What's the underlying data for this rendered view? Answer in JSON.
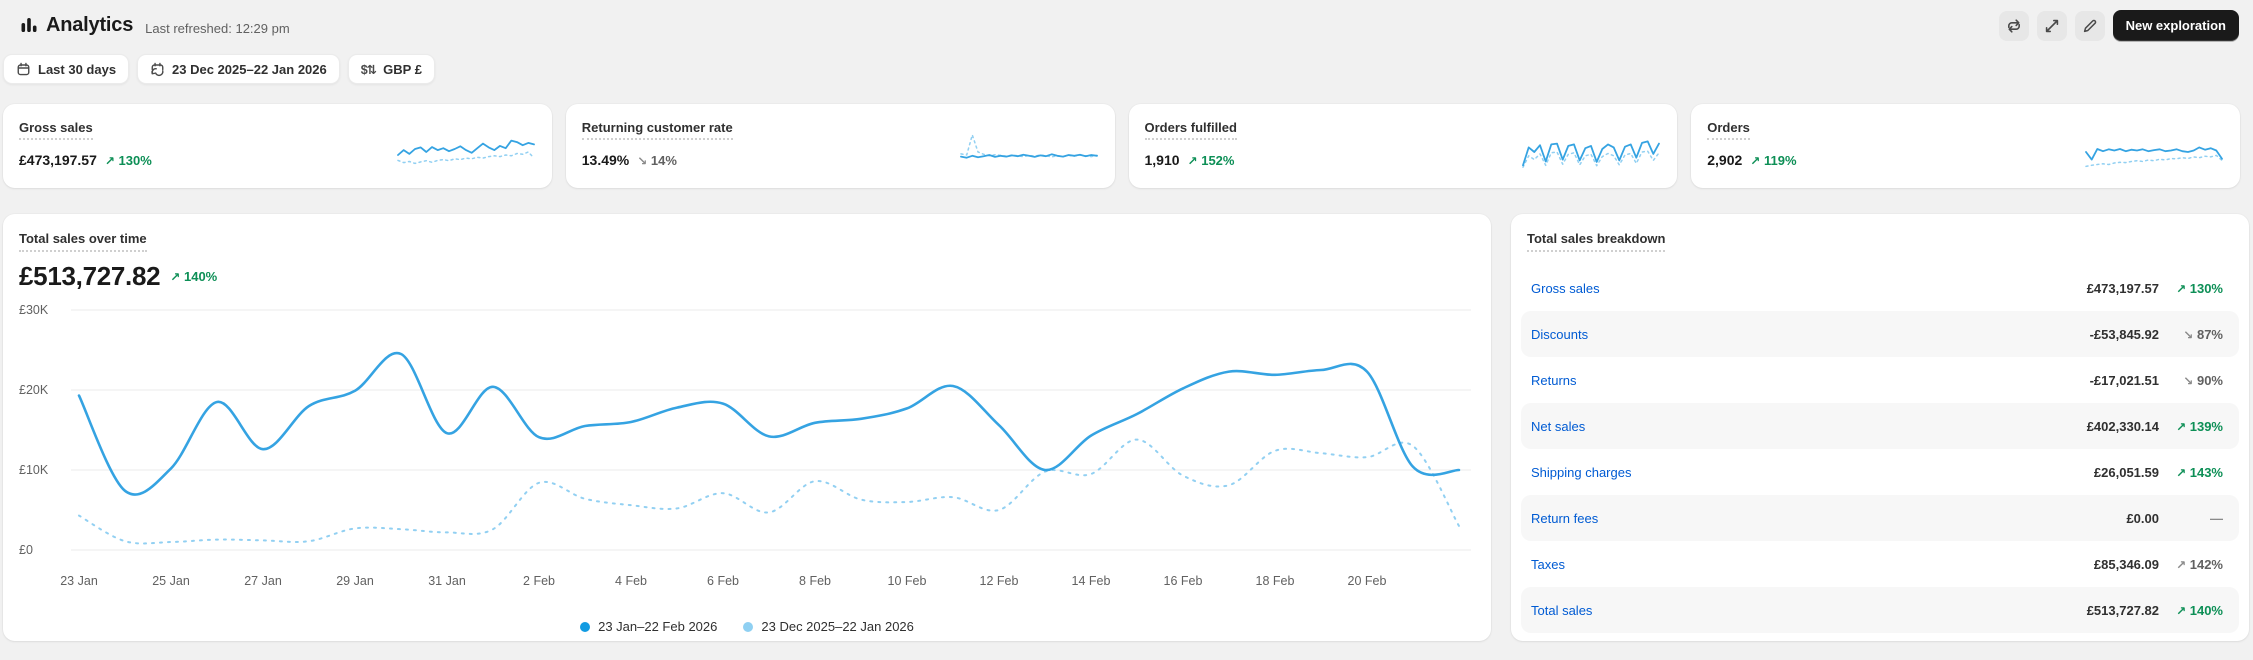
{
  "header": {
    "title": "Analytics",
    "last_refreshed": "Last refreshed: 12:29 pm",
    "new_exploration_label": "New exploration",
    "icon_actions": [
      "cycle-icon",
      "expand-icon",
      "edit-icon"
    ]
  },
  "filters": {
    "date_range": "Last 30 days",
    "compare_range": "23 Dec 2025–22 Jan 2026",
    "currency": "GBP £"
  },
  "colors": {
    "line_current": "#35a3e2",
    "line_previous": "#92d0f2",
    "legend_dot_current": "#119be2",
    "legend_dot_previous": "#8fd0f2",
    "success_green": "#0d8f56",
    "link_blue": "#005bd3",
    "grid": "#ebebeb"
  },
  "metric_cards": [
    {
      "label": "Gross sales",
      "value": "£473,197.57",
      "change": "130%",
      "direction": "up",
      "positive": true,
      "spark_current": [
        0.42,
        0.55,
        0.45,
        0.58,
        0.62,
        0.5,
        0.63,
        0.55,
        0.6,
        0.52,
        0.58,
        0.65,
        0.55,
        0.48,
        0.6,
        0.72,
        0.62,
        0.55,
        0.66,
        0.6,
        0.8,
        0.76,
        0.68,
        0.74,
        0.7
      ],
      "spark_previous": [
        0.28,
        0.22,
        0.25,
        0.2,
        0.24,
        0.27,
        0.23,
        0.28,
        0.3,
        0.27,
        0.32,
        0.3,
        0.34,
        0.32,
        0.36,
        0.34,
        0.38,
        0.4,
        0.38,
        0.42,
        0.4,
        0.46,
        0.44,
        0.5,
        0.34
      ]
    },
    {
      "label": "Returning customer rate",
      "value": "13.49%",
      "change": "14%",
      "direction": "down",
      "positive": false,
      "spark_current": [
        0.38,
        0.35,
        0.4,
        0.36,
        0.39,
        0.42,
        0.37,
        0.4,
        0.38,
        0.41,
        0.39,
        0.43,
        0.4,
        0.37,
        0.41,
        0.39,
        0.44,
        0.4,
        0.38,
        0.42,
        0.4,
        0.43,
        0.39,
        0.42,
        0.4
      ],
      "spark_previous": [
        0.45,
        0.42,
        0.95,
        0.5,
        0.44,
        0.4,
        0.43,
        0.41,
        0.39,
        0.42,
        0.4,
        0.38,
        0.41,
        0.39,
        0.42,
        0.4,
        0.37,
        0.4,
        0.38,
        0.41,
        0.39,
        0.42,
        0.4,
        0.38,
        0.41
      ]
    },
    {
      "label": "Orders fulfilled",
      "value": "1,910",
      "change": "152%",
      "direction": "up",
      "positive": true,
      "spark_current": [
        0.15,
        0.62,
        0.5,
        0.68,
        0.25,
        0.7,
        0.72,
        0.3,
        0.66,
        0.7,
        0.28,
        0.6,
        0.66,
        0.24,
        0.58,
        0.7,
        0.62,
        0.28,
        0.64,
        0.7,
        0.35,
        0.74,
        0.78,
        0.45,
        0.72
      ],
      "spark_previous": [
        0.1,
        0.4,
        0.3,
        0.45,
        0.15,
        0.48,
        0.5,
        0.18,
        0.44,
        0.48,
        0.16,
        0.4,
        0.44,
        0.14,
        0.38,
        0.46,
        0.4,
        0.16,
        0.42,
        0.46,
        0.2,
        0.5,
        0.52,
        0.28,
        0.48
      ]
    },
    {
      "label": "Orders",
      "value": "2,902",
      "change": "119%",
      "direction": "up",
      "positive": true,
      "spark_current": [
        0.5,
        0.3,
        0.58,
        0.52,
        0.57,
        0.54,
        0.58,
        0.52,
        0.56,
        0.54,
        0.57,
        0.52,
        0.55,
        0.57,
        0.52,
        0.54,
        0.57,
        0.52,
        0.5,
        0.54,
        0.62,
        0.56,
        0.6,
        0.54,
        0.32
      ],
      "spark_previous": [
        0.12,
        0.15,
        0.17,
        0.19,
        0.17,
        0.21,
        0.23,
        0.22,
        0.25,
        0.27,
        0.25,
        0.29,
        0.27,
        0.31,
        0.29,
        0.33,
        0.32,
        0.35,
        0.33,
        0.37,
        0.35,
        0.39,
        0.37,
        0.41,
        0.28
      ]
    }
  ],
  "chart_card": {
    "title": "Total sales over time",
    "value": "£513,727.82",
    "change": "140%",
    "direction": "up",
    "positive": true
  },
  "chart_data": {
    "type": "line",
    "title": "Total sales over time",
    "unit": "GBP thousands",
    "x_start": "23 Jan 2026",
    "x_end": "22 Feb 2026",
    "interval": "daily",
    "ylim": [
      0,
      30000
    ],
    "y_ticks": [
      "£30K",
      "£20K",
      "£10K",
      "£0"
    ],
    "x_ticks": [
      "23 Jan",
      "25 Jan",
      "27 Jan",
      "29 Jan",
      "31 Jan",
      "2 Feb",
      "4 Feb",
      "6 Feb",
      "8 Feb",
      "10 Feb",
      "12 Feb",
      "14 Feb",
      "16 Feb",
      "18 Feb",
      "20 Feb"
    ],
    "grid": true,
    "legend_position": "bottom",
    "series": [
      {
        "name": "23 Jan–22 Feb 2026",
        "style": "solid",
        "values_k": [
          19.3,
          7.4,
          10.2,
          18.5,
          12.6,
          18.0,
          19.9,
          24.5,
          14.6,
          20.4,
          14.1,
          15.5,
          16.0,
          17.8,
          18.3,
          14.2,
          15.9,
          16.4,
          17.7,
          20.5,
          15.6,
          10.0,
          14.3,
          17.0,
          20.2,
          22.3,
          21.9,
          22.5,
          22.3,
          10.4,
          10.0
        ]
      },
      {
        "name": "23 Dec 2025–22 Jan 2026",
        "style": "dotted",
        "values_k": [
          4.3,
          1.1,
          1.0,
          1.3,
          1.2,
          1.1,
          2.7,
          2.6,
          2.2,
          2.6,
          8.4,
          6.4,
          5.6,
          5.2,
          7.1,
          4.7,
          8.6,
          6.3,
          6.0,
          6.6,
          5.0,
          9.8,
          9.5,
          13.8,
          9.3,
          8.1,
          12.4,
          12.1,
          11.6,
          13.0,
          3.0
        ]
      }
    ]
  },
  "breakdown": {
    "title": "Total sales breakdown",
    "rows": [
      {
        "label": "Gross sales",
        "value": "£473,197.57",
        "change": "130%",
        "direction": "up",
        "positive": true
      },
      {
        "label": "Discounts",
        "value": "-£53,845.92",
        "change": "87%",
        "direction": "down",
        "positive": false
      },
      {
        "label": "Returns",
        "value": "-£17,021.51",
        "change": "90%",
        "direction": "down",
        "positive": false
      },
      {
        "label": "Net sales",
        "value": "£402,330.14",
        "change": "139%",
        "direction": "up",
        "positive": true
      },
      {
        "label": "Shipping charges",
        "value": "£26,051.59",
        "change": "143%",
        "direction": "up",
        "positive": true
      },
      {
        "label": "Return fees",
        "value": "£0.00",
        "change": "—",
        "direction": "none",
        "positive": false
      },
      {
        "label": "Taxes",
        "value": "£85,346.09",
        "change": "142%",
        "direction": "up",
        "positive": false
      },
      {
        "label": "Total sales",
        "value": "£513,727.82",
        "change": "140%",
        "direction": "up",
        "positive": true
      }
    ]
  }
}
